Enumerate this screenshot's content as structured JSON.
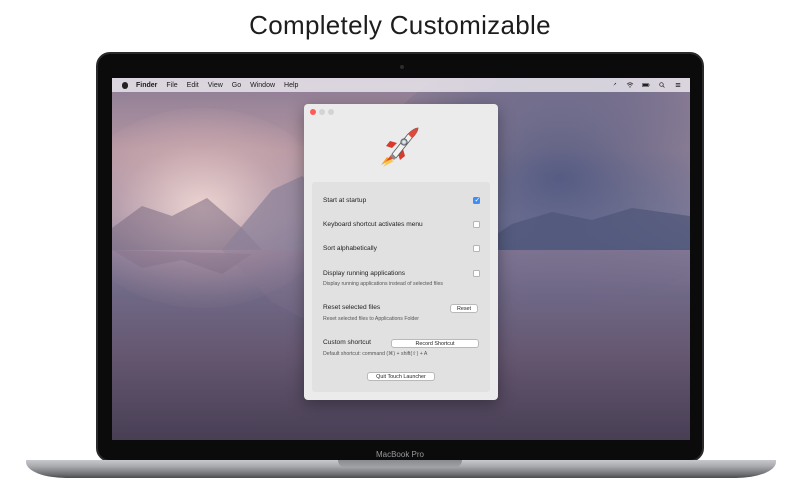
{
  "headline": "Completely Customizable",
  "device_label": "MacBook Pro",
  "menubar": {
    "app": "Finder",
    "items": [
      "File",
      "Edit",
      "View",
      "Go",
      "Window",
      "Help"
    ],
    "status_icons": [
      "launcher-rocket-icon",
      "wifi-icon",
      "battery-icon",
      "search-icon",
      "list-icon"
    ]
  },
  "window": {
    "icon": "rocket-icon",
    "settings": [
      {
        "label": "Start at startup",
        "checked": true
      },
      {
        "label": "Keyboard shortcut activates menu",
        "checked": false
      },
      {
        "label": "Sort alphabetically",
        "checked": false
      },
      {
        "label": "Display running applications",
        "sub": "Display running applications instead of selected files",
        "checked": false
      }
    ],
    "reset": {
      "label": "Reset selected files",
      "sub": "Reset selected files to Applications Folder",
      "button": "Reset"
    },
    "shortcut": {
      "label": "Custom shortcut",
      "sub": "Default shortcut: command (⌘) + shift(⇧) + A",
      "button": "Record Shortcut"
    },
    "quit_button": "Quit Touch Launcher"
  },
  "colors": {
    "checkbox_on": "#3d8ef7",
    "close": "#fc5b57"
  }
}
